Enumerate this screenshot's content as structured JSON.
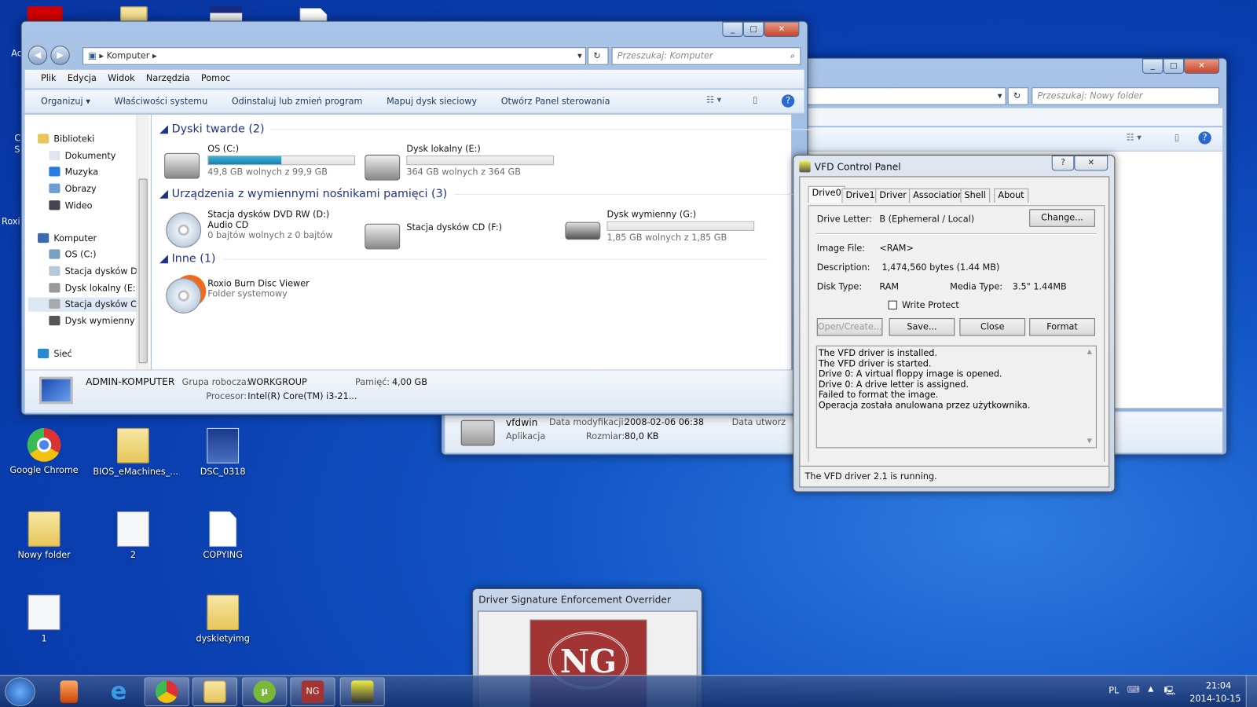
{
  "desktop": {
    "icons": [
      {
        "label": "Google Chrome",
        "type": "chrome"
      },
      {
        "label": "BIOS_eMachines_...",
        "type": "folder"
      },
      {
        "label": "DSC_0318",
        "type": "image"
      },
      {
        "label": "Nowy folder",
        "type": "folder"
      },
      {
        "label": "2",
        "type": "document"
      },
      {
        "label": "COPYING",
        "type": "file"
      },
      {
        "label": "1",
        "type": "document"
      },
      {
        "label": "dyskietyimg",
        "type": "folder"
      }
    ],
    "cut_labels": [
      "Ac",
      "C",
      "S",
      "Roxi"
    ]
  },
  "back_window": {
    "search_placeholder": "Przeszukaj: Nowy folder",
    "details": {
      "name": "vfdwin",
      "type": "Aplikacja",
      "modified_label": "Data modyfikacji:",
      "modified": "2008-02-06 06:38",
      "size_label": "Rozmiar:",
      "size": "80,0 KB",
      "created_label": "Data utworz"
    }
  },
  "explorer": {
    "breadcrumb": "Komputer",
    "search_placeholder": "Przeszukaj: Komputer",
    "menu": [
      "Plik",
      "Edycja",
      "Widok",
      "Narzędzia",
      "Pomoc"
    ],
    "commands": [
      "Organizuj ▾",
      "Właściwości systemu",
      "Odinstaluj lub zmień program",
      "Mapuj dysk sieciowy",
      "Otwórz Panel sterowania"
    ],
    "nav": [
      {
        "label": "Biblioteki",
        "level": 0,
        "color": "#e7c65a"
      },
      {
        "label": "Dokumenty",
        "level": 1,
        "color": "#dfe6ee"
      },
      {
        "label": "Muzyka",
        "level": 1,
        "color": "#2a7be0"
      },
      {
        "label": "Obrazy",
        "level": 1,
        "color": "#6a9fd0"
      },
      {
        "label": "Wideo",
        "level": 1,
        "color": "#445"
      },
      {
        "label": "Komputer",
        "level": 0,
        "color": "#3a6ab0"
      },
      {
        "label": "OS (C:)",
        "level": 1,
        "color": "#7aa0c0"
      },
      {
        "label": "Stacja dysków DVD",
        "level": 1,
        "color": "#b8c8d8"
      },
      {
        "label": "Dysk lokalny (E:)",
        "level": 1,
        "color": "#999"
      },
      {
        "label": "Stacja dysków CD",
        "level": 1,
        "color": "#aaa",
        "selected": true
      },
      {
        "label": "Dysk wymienny (",
        "level": 1,
        "color": "#555"
      },
      {
        "label": "Sieć",
        "level": 0,
        "color": "#2a8ad0"
      }
    ],
    "groups": [
      {
        "title": "Dyski twarde (2)"
      },
      {
        "title": "Urządzenia z wymiennymi nośnikami pamięci (3)"
      },
      {
        "title": "Inne (1)"
      }
    ],
    "drives": [
      {
        "name": "OS (C:)",
        "sub": "49,8 GB wolnych z 99,9 GB",
        "used_fraction": 0.5
      },
      {
        "name": "Dysk lokalny (E:)",
        "sub": "364 GB wolnych z 364 GB",
        "used_fraction": 0.0
      },
      {
        "name": "Stacja dysków DVD RW (D:) Audio CD",
        "sub": "0 bajtów wolnych z 0 bajtów"
      },
      {
        "name": "Stacja dysków CD (F:)"
      },
      {
        "name": "Dysk wymienny (G:)",
        "sub": "1,85 GB wolnych z 1,85 GB",
        "used_fraction": 0.0
      },
      {
        "name": "Roxio Burn Disc Viewer",
        "sub": "Folder systemowy"
      }
    ],
    "details": {
      "computer": "ADMIN-KOMPUTER",
      "workgroup_label": "Grupa robocza:",
      "workgroup": "WORKGROUP",
      "memory_label": "Pamięć:",
      "memory": "4,00 GB",
      "cpu_label": "Procesor:",
      "cpu": "Intel(R) Core(TM) i3-21..."
    }
  },
  "vfd": {
    "title": "VFD Control Panel",
    "tabs": [
      "Drive0",
      "Drive1",
      "Driver",
      "Association",
      "Shell",
      "About"
    ],
    "drive_letter_label": "Drive Letter:",
    "drive_letter": "B (Ephemeral / Local)",
    "change": "Change...",
    "image_file_label": "Image File:",
    "image_file": "<RAM>",
    "description_label": "Description:",
    "description": "1,474,560 bytes (1.44 MB)",
    "disk_type_label": "Disk Type:",
    "disk_type": "RAM",
    "media_type_label": "Media Type:",
    "media_type": "3.5\"  1.44MB",
    "write_protect": "Write Protect",
    "write_protect_checked": false,
    "buttons": [
      "Open/Create...",
      "Save...",
      "Close",
      "Format"
    ],
    "log": [
      "The VFD driver is installed.",
      "The VFD driver is started.",
      "Drive 0: A virtual floppy image is opened.",
      "Drive 0: A drive letter is assigned.",
      "Failed to format the image.",
      "Operacja została anulowana przez użytkownika."
    ],
    "status": "The VFD driver 2.1 is running."
  },
  "dseo": {
    "title": "Driver Signature Enforcement Overrider",
    "logo_text": "NG",
    "logo_color": "#a33434"
  },
  "taskbar": {
    "apps": [
      "start",
      "windows-media-player",
      "internet-explorer",
      "chrome",
      "explorer",
      "utorrent",
      "dseo",
      "vfd"
    ],
    "lang": "PL",
    "time": "21:04",
    "date": "2014-10-15"
  }
}
